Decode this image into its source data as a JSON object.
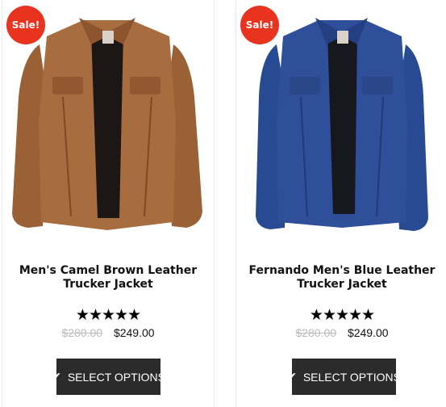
{
  "products": [
    {
      "sale_badge": "Sale!",
      "title_line1": "Men's Camel Brown Leather",
      "title_line2": "Trucker Jacket",
      "rating_stars": "★★★★★",
      "rating": 5,
      "old_price": "$280.00",
      "price": "$249.00",
      "button_label": "SELECT OPTIONS",
      "button_icon": "check-icon",
      "jacket_color": "#a86d3e"
    },
    {
      "sale_badge": "Sale!",
      "title_line1": "Fernando Men's Blue Leather",
      "title_line2": "Trucker Jacket",
      "rating_stars": "★★★★★",
      "rating": 5,
      "old_price": "$280.00",
      "price": "$249.00",
      "button_label": "SELECT OPTIONS",
      "button_icon": "check-icon",
      "jacket_color": "#2f4f9a"
    }
  ],
  "colors": {
    "sale_badge": "#e8331f",
    "button_bg": "#2b2b2b",
    "old_price": "#bbbbbb"
  }
}
